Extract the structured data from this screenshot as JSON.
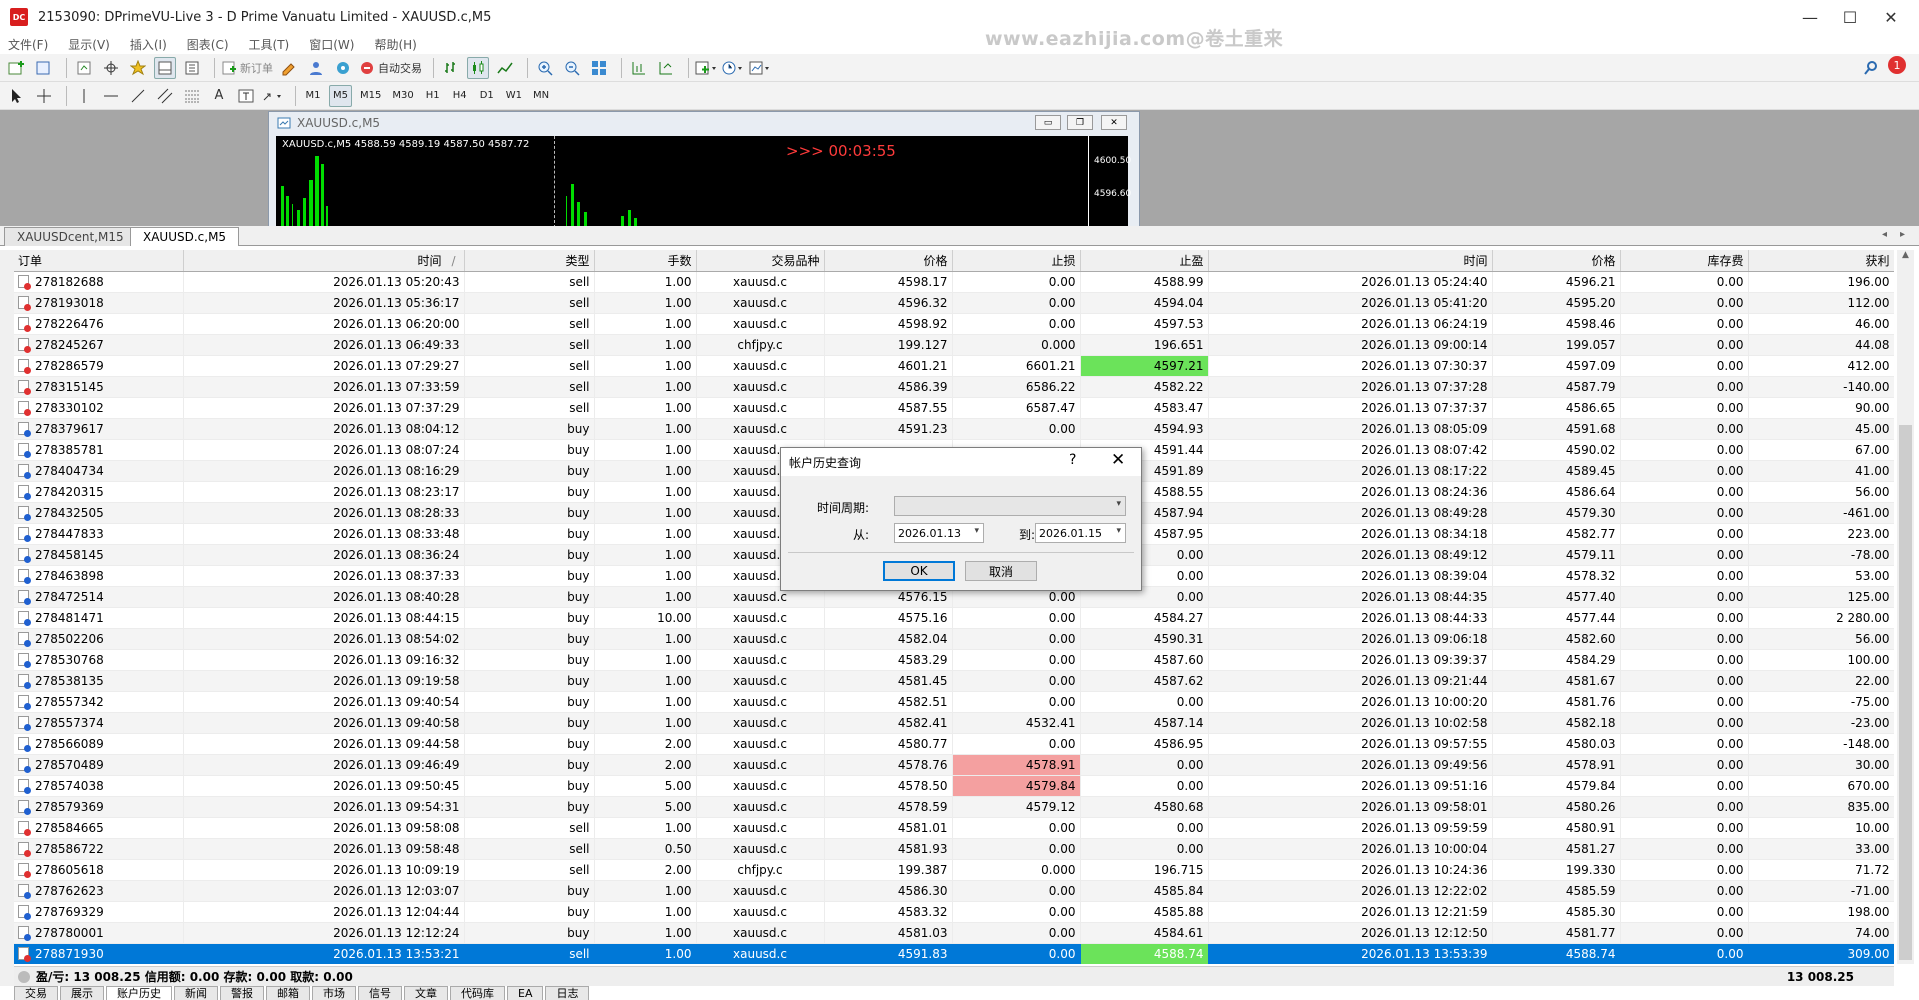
{
  "window": {
    "title": "2153090: DPrimeVU-Live 3 - D Prime Vanuatu Limited - XAUUSD.c,M5",
    "app_icon_text": "DC",
    "watermark": "www.eazhijia.com@卷土重来",
    "minimize": "—",
    "maximize": "☐",
    "close": "✕"
  },
  "menu": [
    "文件(F)",
    "显示(V)",
    "插入(I)",
    "图表(C)",
    "工具(T)",
    "窗口(W)",
    "帮助(H)"
  ],
  "toolbar": {
    "new_order": "新订单",
    "auto_trade": "自动交易",
    "timeframes": [
      "M1",
      "M5",
      "M15",
      "M30",
      "H1",
      "H4",
      "D1",
      "W1",
      "MN"
    ],
    "selected_timeframe": "M5",
    "notification_count": "1"
  },
  "chart_window": {
    "title": "XAUUSD.c,M5",
    "info": "XAUUSD.c,M5  4588.59 4589.19 4587.50 4587.72",
    "countdown": ">>> 00:03:55",
    "price_labels": [
      "4600.50",
      "4596.60"
    ]
  },
  "chart_tabs": [
    "XAUUSDcent,M15",
    "XAUUSD.c,M5"
  ],
  "active_chart_tab": "XAUUSD.c,M5",
  "table": {
    "headers": [
      "订单",
      "时间",
      "类型",
      "手数",
      "交易品种",
      "价格",
      "止损",
      "止盈",
      "时间",
      "价格",
      "库存费",
      "获利"
    ],
    "sort_marker": "/",
    "rows": [
      [
        "278182688",
        "2026.01.13 05:20:43",
        "sell",
        "1.00",
        "xauusd.c",
        "4598.17",
        "0.00",
        "4588.99",
        "2026.01.13 05:24:40",
        "4596.21",
        "0.00",
        "196.00"
      ],
      [
        "278193018",
        "2026.01.13 05:36:17",
        "sell",
        "1.00",
        "xauusd.c",
        "4596.32",
        "0.00",
        "4594.04",
        "2026.01.13 05:41:20",
        "4595.20",
        "0.00",
        "112.00"
      ],
      [
        "278226476",
        "2026.01.13 06:20:00",
        "sell",
        "1.00",
        "xauusd.c",
        "4598.92",
        "0.00",
        "4597.53",
        "2026.01.13 06:24:19",
        "4598.46",
        "0.00",
        "46.00"
      ],
      [
        "278245267",
        "2026.01.13 06:49:33",
        "sell",
        "1.00",
        "chfjpy.c",
        "199.127",
        "0.000",
        "196.651",
        "2026.01.13 09:00:14",
        "199.057",
        "0.00",
        "44.08"
      ],
      [
        "278286579",
        "2026.01.13 07:29:27",
        "sell",
        "1.00",
        "xauusd.c",
        "4601.21",
        "6601.21",
        "4597.21",
        "2026.01.13 07:30:37",
        "4597.09",
        "0.00",
        "412.00"
      ],
      [
        "278315145",
        "2026.01.13 07:33:59",
        "sell",
        "1.00",
        "xauusd.c",
        "4586.39",
        "6586.22",
        "4582.22",
        "2026.01.13 07:37:28",
        "4587.79",
        "0.00",
        "-140.00"
      ],
      [
        "278330102",
        "2026.01.13 07:37:29",
        "sell",
        "1.00",
        "xauusd.c",
        "4587.55",
        "6587.47",
        "4583.47",
        "2026.01.13 07:37:37",
        "4586.65",
        "0.00",
        "90.00"
      ],
      [
        "278379617",
        "2026.01.13 08:04:12",
        "buy",
        "1.00",
        "xauusd.c",
        "4591.23",
        "0.00",
        "4594.93",
        "2026.01.13 08:05:09",
        "4591.68",
        "0.00",
        "45.00"
      ],
      [
        "278385781",
        "2026.01.13 08:07:24",
        "buy",
        "1.00",
        "xauusd.c",
        "",
        "",
        "4591.44",
        "2026.01.13 08:07:42",
        "4590.02",
        "0.00",
        "67.00"
      ],
      [
        "278404734",
        "2026.01.13 08:16:29",
        "buy",
        "1.00",
        "xauusd.c",
        "",
        "",
        "4591.89",
        "2026.01.13 08:17:22",
        "4589.45",
        "0.00",
        "41.00"
      ],
      [
        "278420315",
        "2026.01.13 08:23:17",
        "buy",
        "1.00",
        "xauusd.c",
        "",
        "",
        "4588.55",
        "2026.01.13 08:24:36",
        "4586.64",
        "0.00",
        "56.00"
      ],
      [
        "278432505",
        "2026.01.13 08:28:33",
        "buy",
        "1.00",
        "xauusd.c",
        "",
        "",
        "4587.94",
        "2026.01.13 08:49:28",
        "4579.30",
        "0.00",
        "-461.00"
      ],
      [
        "278447833",
        "2026.01.13 08:33:48",
        "buy",
        "1.00",
        "xauusd.c",
        "",
        "",
        "4587.95",
        "2026.01.13 08:34:18",
        "4582.77",
        "0.00",
        "223.00"
      ],
      [
        "278458145",
        "2026.01.13 08:36:24",
        "buy",
        "1.00",
        "xauusd.c",
        "",
        "",
        "0.00",
        "2026.01.13 08:49:12",
        "4579.11",
        "0.00",
        "-78.00"
      ],
      [
        "278463898",
        "2026.01.13 08:37:33",
        "buy",
        "1.00",
        "xauusd.c",
        "",
        "",
        "0.00",
        "2026.01.13 08:39:04",
        "4578.32",
        "0.00",
        "53.00"
      ],
      [
        "278472514",
        "2026.01.13 08:40:28",
        "buy",
        "1.00",
        "xauusd.c",
        "4576.15",
        "0.00",
        "0.00",
        "2026.01.13 08:44:35",
        "4577.40",
        "0.00",
        "125.00"
      ],
      [
        "278481471",
        "2026.01.13 08:44:15",
        "buy",
        "10.00",
        "xauusd.c",
        "4575.16",
        "0.00",
        "4584.27",
        "2026.01.13 08:44:33",
        "4577.44",
        "0.00",
        "2 280.00"
      ],
      [
        "278502206",
        "2026.01.13 08:54:02",
        "buy",
        "1.00",
        "xauusd.c",
        "4582.04",
        "0.00",
        "4590.31",
        "2026.01.13 09:06:18",
        "4582.60",
        "0.00",
        "56.00"
      ],
      [
        "278530768",
        "2026.01.13 09:16:32",
        "buy",
        "1.00",
        "xauusd.c",
        "4583.29",
        "0.00",
        "4587.60",
        "2026.01.13 09:39:37",
        "4584.29",
        "0.00",
        "100.00"
      ],
      [
        "278538135",
        "2026.01.13 09:19:58",
        "buy",
        "1.00",
        "xauusd.c",
        "4581.45",
        "0.00",
        "4587.62",
        "2026.01.13 09:21:44",
        "4581.67",
        "0.00",
        "22.00"
      ],
      [
        "278557342",
        "2026.01.13 09:40:54",
        "buy",
        "1.00",
        "xauusd.c",
        "4582.51",
        "0.00",
        "0.00",
        "2026.01.13 10:00:20",
        "4581.76",
        "0.00",
        "-75.00"
      ],
      [
        "278557374",
        "2026.01.13 09:40:58",
        "buy",
        "1.00",
        "xauusd.c",
        "4582.41",
        "4532.41",
        "4587.14",
        "2026.01.13 10:02:58",
        "4582.18",
        "0.00",
        "-23.00"
      ],
      [
        "278566089",
        "2026.01.13 09:44:58",
        "buy",
        "2.00",
        "xauusd.c",
        "4580.77",
        "0.00",
        "4586.95",
        "2026.01.13 09:57:55",
        "4580.03",
        "0.00",
        "-148.00"
      ],
      [
        "278570489",
        "2026.01.13 09:46:49",
        "buy",
        "2.00",
        "xauusd.c",
        "4578.76",
        "4578.91",
        "0.00",
        "2026.01.13 09:49:56",
        "4578.91",
        "0.00",
        "30.00"
      ],
      [
        "278574038",
        "2026.01.13 09:50:45",
        "buy",
        "5.00",
        "xauusd.c",
        "4578.50",
        "4579.84",
        "0.00",
        "2026.01.13 09:51:16",
        "4579.84",
        "0.00",
        "670.00"
      ],
      [
        "278579369",
        "2026.01.13 09:54:31",
        "buy",
        "5.00",
        "xauusd.c",
        "4578.59",
        "4579.12",
        "4580.68",
        "2026.01.13 09:58:01",
        "4580.26",
        "0.00",
        "835.00"
      ],
      [
        "278584665",
        "2026.01.13 09:58:08",
        "sell",
        "1.00",
        "xauusd.c",
        "4581.01",
        "0.00",
        "0.00",
        "2026.01.13 09:59:59",
        "4580.91",
        "0.00",
        "10.00"
      ],
      [
        "278586722",
        "2026.01.13 09:58:48",
        "sell",
        "0.50",
        "xauusd.c",
        "4581.93",
        "0.00",
        "0.00",
        "2026.01.13 10:00:04",
        "4581.27",
        "0.00",
        "33.00"
      ],
      [
        "278605618",
        "2026.01.13 10:09:19",
        "sell",
        "2.00",
        "chfjpy.c",
        "199.387",
        "0.000",
        "196.715",
        "2026.01.13 10:24:36",
        "199.330",
        "0.00",
        "71.72"
      ],
      [
        "278762623",
        "2026.01.13 12:03:07",
        "buy",
        "1.00",
        "xauusd.c",
        "4586.30",
        "0.00",
        "4585.84",
        "2026.01.13 12:22:02",
        "4585.59",
        "0.00",
        "-71.00"
      ],
      [
        "278769329",
        "2026.01.13 12:04:44",
        "buy",
        "1.00",
        "xauusd.c",
        "4583.32",
        "0.00",
        "4585.88",
        "2026.01.13 12:21:59",
        "4585.30",
        "0.00",
        "198.00"
      ],
      [
        "278780001",
        "2026.01.13 12:12:24",
        "buy",
        "1.00",
        "xauusd.c",
        "4581.03",
        "0.00",
        "4584.61",
        "2026.01.13 12:12:50",
        "4581.77",
        "0.00",
        "74.00"
      ],
      [
        "278871930",
        "2026.01.13 13:53:21",
        "sell",
        "1.00",
        "xauusd.c",
        "4591.83",
        "0.00",
        "4588.74",
        "2026.01.13 13:53:39",
        "4588.74",
        "0.00",
        "309.00"
      ]
    ]
  },
  "colors": {
    "highlight_green": "#6be35a",
    "highlight_red": "#f4a0a0",
    "selected_row": "#0078d7"
  },
  "summary": {
    "text": "盈/亏: 13 008.25  信用额: 0.00  存款: 0.00  取款: 0.00",
    "total": "13 008.25"
  },
  "bottom_tabs": [
    "交易",
    "展示",
    "账户历史",
    "新闻",
    "警报",
    "邮箱",
    "市场",
    "信号",
    "文章",
    "代码库",
    "EA",
    "日志"
  ],
  "active_bottom_tab": "账户历史",
  "dialog": {
    "title": "帐户历史查询",
    "help": "?",
    "close": "✕",
    "period_label": "时间周期:",
    "period_value": "",
    "from_label": "从:",
    "from_value": "2026.01.13",
    "to_label": "到:",
    "to_value": "2026.01.15",
    "ok": "OK",
    "cancel": "取消"
  }
}
